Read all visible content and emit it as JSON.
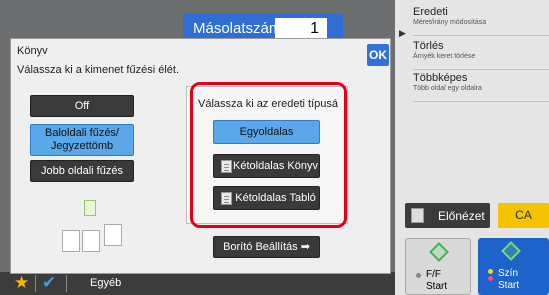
{
  "header": {
    "copies_label": "Másolatszám",
    "copies_value": "1"
  },
  "right_panel": {
    "items": [
      {
        "title": "Eredeti",
        "subtitle": "Méret/irány módosítása"
      },
      {
        "title": "Törlés",
        "subtitle": "Árnyék keret törlése"
      },
      {
        "title": "Többképes",
        "subtitle": "Több oldal egy oldalra"
      }
    ],
    "preview_label": "Előnézet",
    "ca_label": "CA",
    "start_bw": {
      "line1": "F/F",
      "line2": "Start"
    },
    "start_color": {
      "line1": "Szín",
      "line2": "Start"
    }
  },
  "bottom_bar": {
    "other_label": "Egyéb"
  },
  "dialog": {
    "title": "Könyv",
    "instruction": "Válassza ki a kimenet fűzési élét.",
    "ok_label": "OK",
    "binding": {
      "off": "Off",
      "left": "Baloldali fűzés/ Jegyzettömb",
      "right": "Jobb oldali fűzés"
    },
    "type_title": "Válassza ki az eredeti típusá",
    "types": {
      "single": "Egyoldalas",
      "double_book": "Kétoldalas Könyv",
      "double_tablet": "Kétoldalas Tabló"
    },
    "cover_label": "Borító Beállítás"
  },
  "colors": {
    "accent": "#2f73d8",
    "selected": "#5aa7ea",
    "highlight": "#e0001b"
  }
}
